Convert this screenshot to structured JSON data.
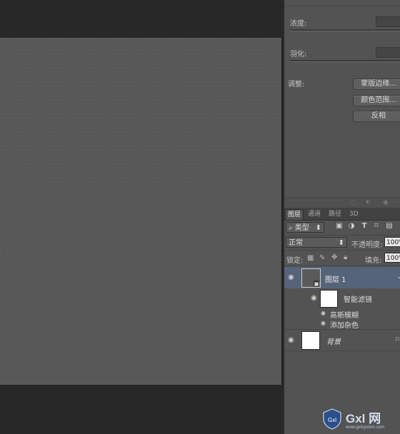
{
  "properties": {
    "density_label": "浓度:",
    "feather_label": "羽化:",
    "adjust_label": "调整:",
    "buttons": [
      "蒙版边缘...",
      "颜色范围...",
      "反相"
    ]
  },
  "layers_panel": {
    "tabs": [
      "图层",
      "通道",
      "路径",
      "3D"
    ],
    "filter_kind": "类型",
    "filter_icons": [
      "image-filter-icon",
      "adjustment-filter-icon",
      "type-filter-icon",
      "shape-filter-icon",
      "smart-object-filter-icon"
    ],
    "blend_mode": "正常",
    "opacity_label": "不透明度:",
    "opacity_value": "100%",
    "lock_label": "锁定:",
    "fill_label": "填充:",
    "fill_value": "100%",
    "layers": [
      {
        "name": "图层 1",
        "selected": true,
        "smart_object": true
      },
      {
        "name": "背景",
        "italic": true
      }
    ],
    "smart_filters_label": "智能滤镜",
    "filters": [
      "高斯模糊",
      "添加杂色"
    ]
  },
  "watermark": {
    "brand": "Gxl 网",
    "url": "www.gxlsystem.com"
  },
  "colors": {
    "canvas": "#565656",
    "workspace": "#282828",
    "panel": "#535353",
    "selected_layer": "#56647a"
  }
}
